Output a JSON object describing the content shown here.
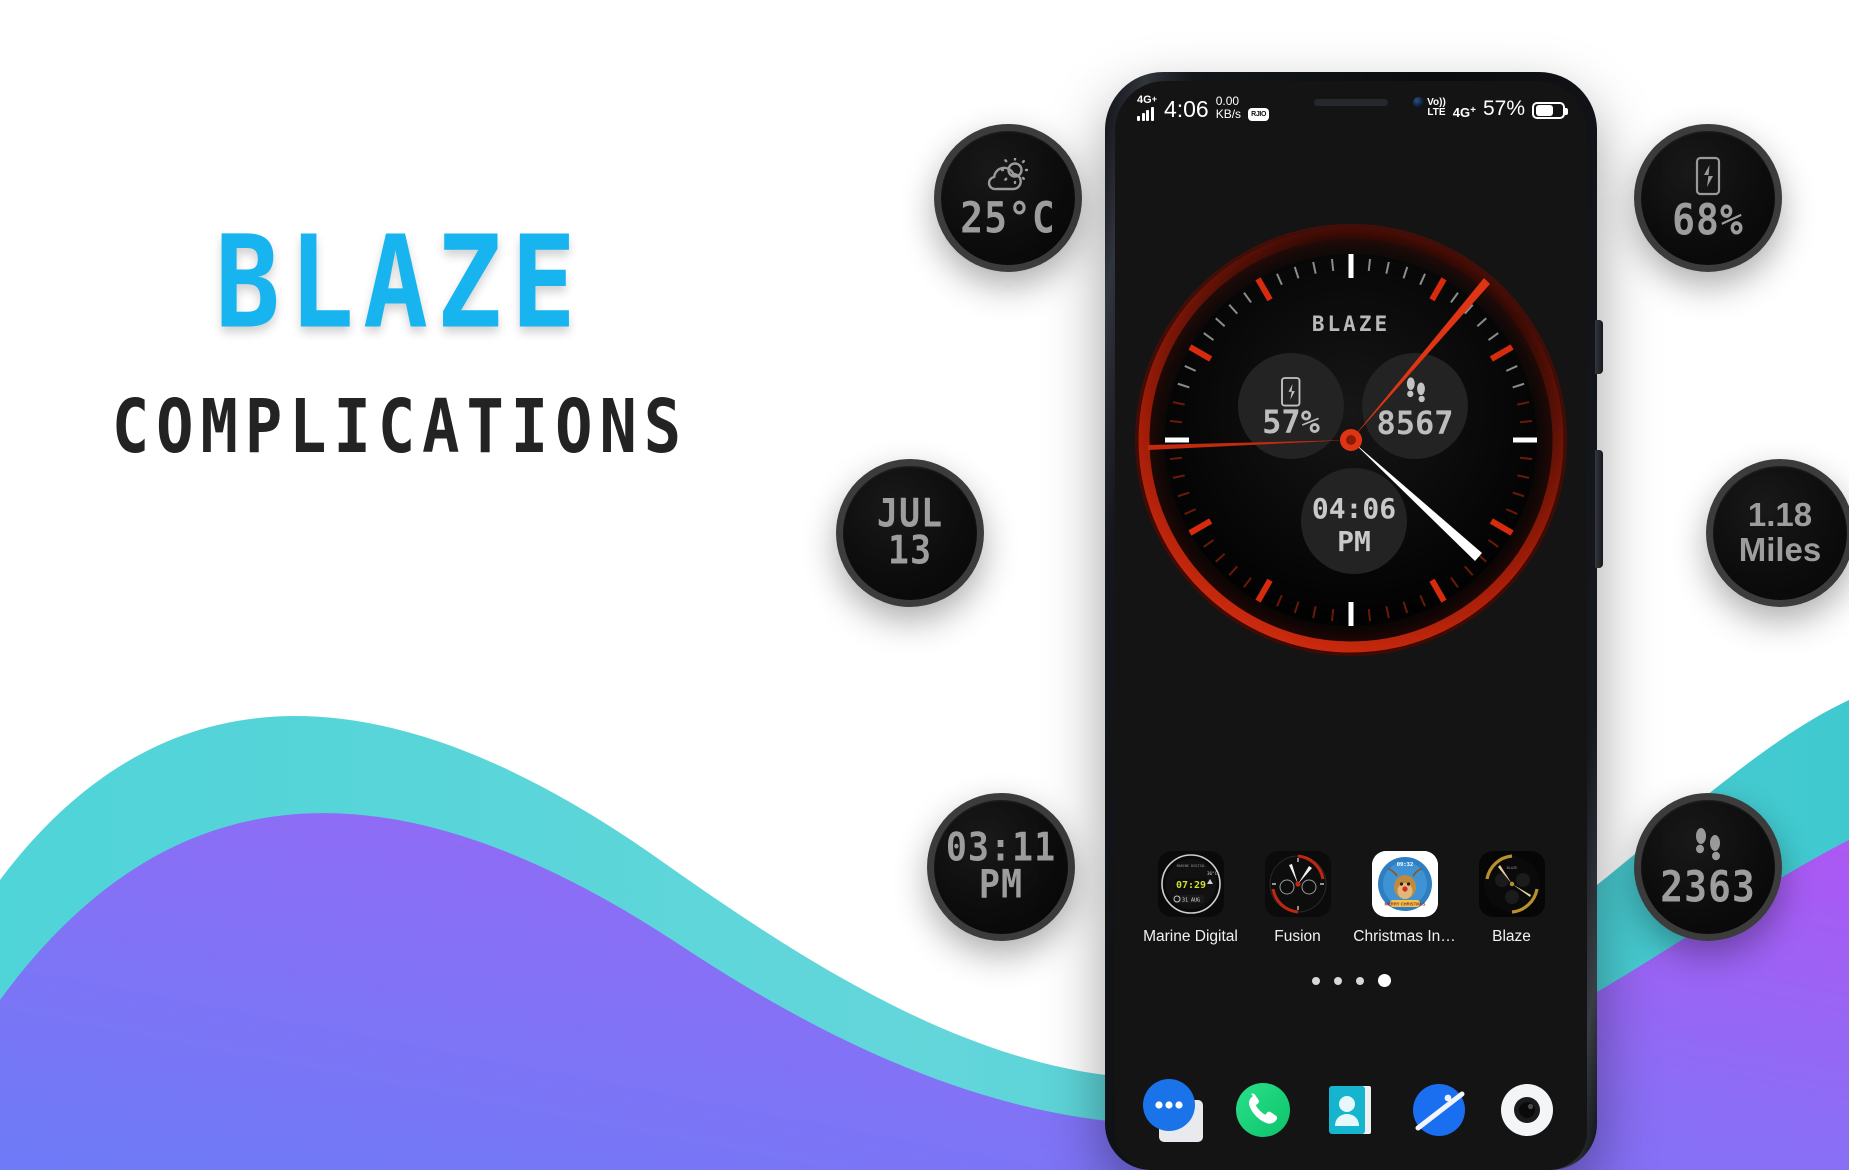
{
  "promo": {
    "title": "BLAZE",
    "subtitle": "COMPLICATIONS",
    "title_color": "#17b4ef",
    "subtitle_color": "#232323"
  },
  "background": {
    "base_color": "#ffffff",
    "wave_teal": "#5ed3d8",
    "wave_purple_start": "#6d7bf7",
    "wave_purple_end": "#a855f7"
  },
  "complications": [
    {
      "id": "weather",
      "icon": "partly-cloudy-icon",
      "value": "25°C",
      "style": "techno"
    },
    {
      "id": "date",
      "icon": "none",
      "value": "JUL\n13",
      "style": "techno"
    },
    {
      "id": "time",
      "icon": "none",
      "value": "03:11\nPM",
      "style": "techno"
    },
    {
      "id": "battery",
      "icon": "phone-charging-icon",
      "value": "68%",
      "style": "techno"
    },
    {
      "id": "miles",
      "icon": "none",
      "value": "1.18\nMiles",
      "style": "plain"
    },
    {
      "id": "steps",
      "icon": "footsteps-icon",
      "value": "2363",
      "style": "techno"
    }
  ],
  "bubble_values": {
    "weather": "25°C",
    "date_line1": "JUL",
    "date_line2": "13",
    "time_line1": "03:11",
    "time_line2": "PM",
    "battery": "68%",
    "miles_line1": "1.18",
    "miles_line2": "Miles",
    "steps": "2363"
  },
  "phone": {
    "status_bar": {
      "network": "4G",
      "network_plus": "+",
      "clock": "4:06",
      "net_speed_value": "0.00",
      "net_speed_unit": "KB/s",
      "sim_chip": "RJIO",
      "volte_line1": "Vo))",
      "volte_line2": "LTE",
      "network_right": "4G",
      "network_right_plus": "+",
      "battery_percent": "57%"
    },
    "watch_face": {
      "brand": "BLAZE",
      "accent_color": "#d82b0e",
      "subdial_battery_value": "57%",
      "subdial_battery_icon": "phone-charging-icon",
      "subdial_steps_value": "8567",
      "subdial_steps_icon": "footsteps-icon",
      "subdial_time_line1": "04:06",
      "subdial_time_line2": "PM",
      "hour_hand_color": "#ffffff",
      "minute_hand_color": "#d82b0e",
      "second_hand_color": "#d82b0e"
    },
    "apps": [
      {
        "label": "Marine Digital",
        "icon": "watchface-marine-digital-icon"
      },
      {
        "label": "Fusion",
        "icon": "watchface-fusion-icon"
      },
      {
        "label": "Christmas In…",
        "icon": "watchface-christmas-icon"
      },
      {
        "label": "Blaze",
        "icon": "watchface-blaze-icon"
      }
    ],
    "page_dots": {
      "count": 4,
      "active_index": 3
    },
    "dock": [
      {
        "name": "messages-icon",
        "color": "#1a73e8"
      },
      {
        "name": "phone-icon",
        "color": "#1fd67a"
      },
      {
        "name": "contacts-icon",
        "color": "#15b4cf"
      },
      {
        "name": "browser-icon",
        "color": "#1a6ff0"
      },
      {
        "name": "camera-icon",
        "color": "#ffffff"
      }
    ]
  }
}
